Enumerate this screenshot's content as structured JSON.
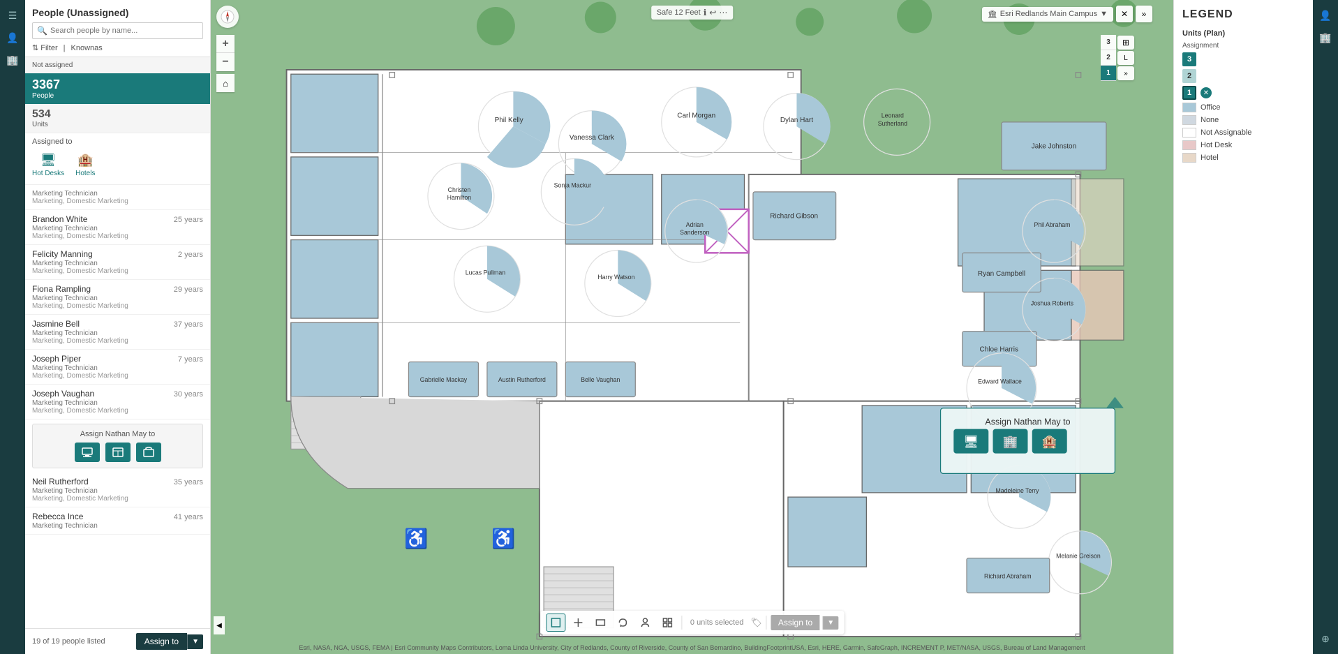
{
  "app": {
    "title": "People (Unassigned)"
  },
  "left_sidebar": {
    "icons": [
      "☰",
      "👤",
      "🏢"
    ]
  },
  "search": {
    "placeholder": "Search people by name..."
  },
  "filter": {
    "label": "Filter",
    "knownas_label": "Knownas"
  },
  "stats": {
    "not_assigned": "Not assigned",
    "people_count": "3367",
    "people_label": "People",
    "units_count": "534",
    "units_label": "Units"
  },
  "assigned_section": {
    "label": "Assigned to",
    "nav_items": [
      {
        "icon": "🖥",
        "label": "Hot Desks"
      },
      {
        "icon": "🏨",
        "label": "Hotels"
      }
    ]
  },
  "people": [
    {
      "name": "Brandon White",
      "years": "25 years",
      "role": "Marketing Technician",
      "dept": "Marketing, Domestic Marketing"
    },
    {
      "name": "Felicity Manning",
      "years": "2 years",
      "role": "Marketing Technician",
      "dept": "Marketing, Domestic Marketing"
    },
    {
      "name": "Fiona Rampling",
      "years": "29 years",
      "role": "Marketing Technician",
      "dept": "Marketing, Domestic Marketing"
    },
    {
      "name": "Jasmine Bell",
      "years": "37 years",
      "role": "Marketing Technician",
      "dept": "Marketing, Domestic Marketing"
    },
    {
      "name": "Joseph Piper",
      "years": "7 years",
      "role": "Marketing Technician",
      "dept": "Marketing, Domestic Marketing"
    },
    {
      "name": "Joseph Vaughan",
      "years": "30 years",
      "role": "Marketing Technician",
      "dept": "Marketing, Domestic Marketing"
    },
    {
      "name": "Neil Rutherford",
      "years": "35 years",
      "role": "Marketing Technician",
      "dept": "Marketing, Domestic Marketing"
    },
    {
      "name": "Rebecca Ince",
      "years": "41 years",
      "role": "Marketing Technician",
      "dept": ""
    }
  ],
  "assign_box": {
    "title": "Assign Nathan May to",
    "icons": [
      "🖥",
      "🏢",
      "🏨"
    ]
  },
  "people_count": "19 of 19 people listed",
  "footer": {
    "assign_label": "Assign to"
  },
  "map": {
    "location": "Esri Redlands Main Campus",
    "safe_distance": "Safe 12 Feet",
    "attribution": "Esri, NASA, NGA, USGS, FEMA | Esri Community Maps Contributors, Loma Linda University, City of Redlands, County of Riverside, County of San Bernardino, BuildingFootprintUSA, Esri, HERE, Garmin, SafeGraph, INCREMENT P, MET/NASA, USGS, Bureau of Land Management",
    "units_selected": "0 units selected",
    "assign_to": "Assign to"
  },
  "assign_popup_map": {
    "title": "Assign Nathan May to",
    "icons": [
      "🖥",
      "🏢",
      "🏨"
    ]
  },
  "legend": {
    "title": "LEGEND",
    "sections": [
      {
        "title": "Units (Plan)",
        "subsections": [
          {
            "label": "Assignment",
            "items": [
              {
                "label": "Office",
                "color": "#a8c8d8"
              },
              {
                "label": "None",
                "color": "#d8d8d8"
              },
              {
                "label": "Not Assignable",
                "color": "#ffffff"
              },
              {
                "label": "Hot Desk",
                "color": "#e8c8c8"
              },
              {
                "label": "Hotel",
                "color": "#e8d8d0"
              }
            ]
          }
        ]
      }
    ],
    "floor_numbers": [
      {
        "label": "3",
        "active": false
      },
      {
        "label": "2",
        "active": false
      },
      {
        "label": "1",
        "active": true
      }
    ],
    "close_icon": "✕"
  },
  "floor_selector": {
    "levels": [
      "L",
      "▼",
      "»"
    ]
  },
  "people_list_header": {
    "first_item": {
      "name": "Marketing Technician",
      "dept": "Marketing,  Domestic Marketing"
    }
  }
}
